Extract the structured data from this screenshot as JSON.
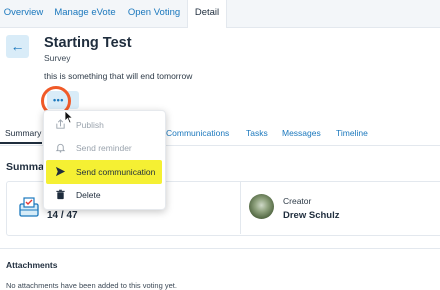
{
  "tabs": [
    {
      "label": "Overview"
    },
    {
      "label": "Manage eVote"
    },
    {
      "label": "Open Voting"
    },
    {
      "label": "Detail"
    }
  ],
  "header": {
    "title": "Starting Test",
    "subtitle": "Survey",
    "description": "this is something that will end tomorrow",
    "more_label": "•••"
  },
  "menu": {
    "items": [
      {
        "label": "Publish",
        "icon": "publish-icon",
        "disabled": true
      },
      {
        "label": "Send reminder",
        "icon": "bell-icon",
        "disabled": true
      },
      {
        "label": "Send communication",
        "icon": "send-icon",
        "disabled": false,
        "highlighted": true
      },
      {
        "label": "Delete",
        "icon": "trash-icon",
        "disabled": false
      }
    ]
  },
  "subtabs": [
    {
      "label": "Summary"
    },
    {
      "label": "Communications"
    },
    {
      "label": "Tasks"
    },
    {
      "label": "Messages"
    },
    {
      "label": "Timeline"
    }
  ],
  "summary": {
    "title": "Summary",
    "count": "14 / 47",
    "creator_label": "Creator",
    "creator_name": "Drew Schulz"
  },
  "attachments": {
    "title": "Attachments",
    "empty_text": "No attachments have been added to this voting yet."
  },
  "colors": {
    "accent": "#1b78bd",
    "highlight": "#f5f033",
    "ring": "#f05a28"
  }
}
